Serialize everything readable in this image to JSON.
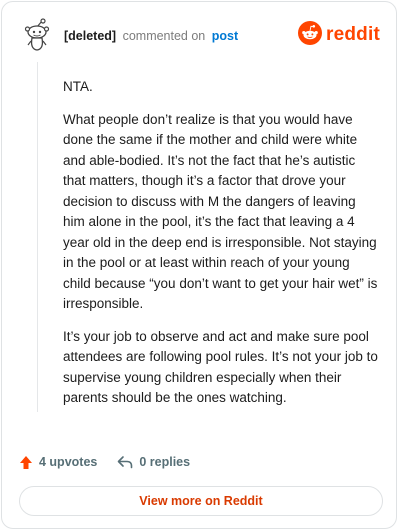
{
  "comment": {
    "author": "[deleted]",
    "action_text": "commented on",
    "post_link": "post",
    "paragraphs": [
      "NTA.",
      "What people don’t realize is that you would have done the same if the mother and child were white and able-bodied. It’s not the fact that he’s autistic that matters, though it’s a factor that drove your decision to discuss with M the dangers of leaving him alone in the pool, it’s the fact that leaving a 4 year old in the deep end is irresponsible. Not staying in the pool or at least within reach of your young child because “you don’t want to get your hair wet” is irresponsible.",
      "It’s your job to observe and act and make sure pool attendees are following pool rules. It’s not your job to supervise young children especially when their parents should be the ones watching."
    ]
  },
  "brand": {
    "wordmark": "reddit",
    "color": "#ff4500",
    "icon": "reddit-logo-icon"
  },
  "actions": {
    "upvotes_label": "4 upvotes",
    "upvote_icon": "upvote-arrow-icon",
    "upvote_color": "#ff4500",
    "replies_label": "0 replies",
    "reply_icon": "reply-arrow-icon"
  },
  "footer": {
    "view_more_label": "View more on Reddit",
    "accent": "#d93a00"
  }
}
